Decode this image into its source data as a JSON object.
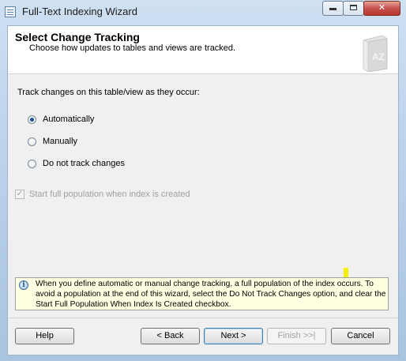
{
  "window": {
    "title": "Full-Text Indexing Wizard",
    "controls": {
      "minimize": "",
      "maximize": "",
      "close": "✕"
    }
  },
  "header": {
    "title": "Select Change Tracking",
    "subtitle": "Choose how updates to tables and views are tracked.",
    "icon": "book-az-icon",
    "icon_text": "AZ"
  },
  "main": {
    "prompt": "Track changes on this table/view as they occur:",
    "options": [
      {
        "label": "Automatically",
        "checked": true
      },
      {
        "label": "Manually",
        "checked": false
      },
      {
        "label": "Do not track changes",
        "checked": false
      }
    ],
    "start_population": {
      "label": "Start full population when index is created",
      "checked": true,
      "enabled": false,
      "check_glyph": "✓"
    }
  },
  "info": {
    "icon": "info-icon",
    "icon_glyph": "i",
    "text": "When you define automatic or manual change tracking, a full population of the index occurs. To avoid a population at the end of this wizard, select the Do Not Track Changes option, and clear the Start Full Population When Index Is Created checkbox."
  },
  "footer": {
    "help": "Help",
    "back": "< Back",
    "next": "Next >",
    "finish": "Finish >>|",
    "cancel": "Cancel"
  },
  "colors": {
    "titlebar": "#bcd3ec",
    "info_background": "#ffffe1",
    "close_button": "#c75050",
    "marker": "#f4ee00"
  }
}
